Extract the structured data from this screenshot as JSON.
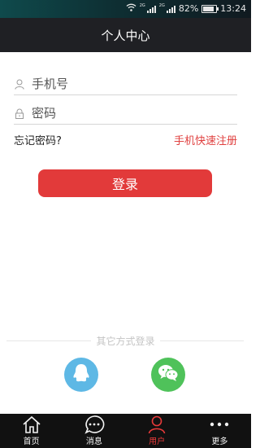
{
  "status_bar": {
    "network_label_1": "2G",
    "network_label_2": "2G",
    "battery_percent": "82%",
    "battery_level": 0.82,
    "time": "13:24"
  },
  "header": {
    "title": "个人中心"
  },
  "login_form": {
    "phone_placeholder": "手机号",
    "password_placeholder": "密码",
    "forgot_password_label": "忘记密码?",
    "quick_register_label": "手机快速注册",
    "login_button_label": "登录"
  },
  "other_login": {
    "divider_label": "其它方式登录",
    "providers": [
      "qq-icon",
      "wechat-icon"
    ]
  },
  "tab_bar": {
    "items": [
      {
        "label": "首页",
        "icon": "home-icon",
        "active": false
      },
      {
        "label": "消息",
        "icon": "message-icon",
        "active": false
      },
      {
        "label": "用户",
        "icon": "user-icon",
        "active": true
      },
      {
        "label": "更多",
        "icon": "more-icon",
        "active": false
      }
    ]
  },
  "colors": {
    "accent": "#e23a3a",
    "title_bar": "#1f2024",
    "tab_bar": "#111111",
    "qq": "#5eb8e5",
    "wechat": "#4fc25a"
  }
}
